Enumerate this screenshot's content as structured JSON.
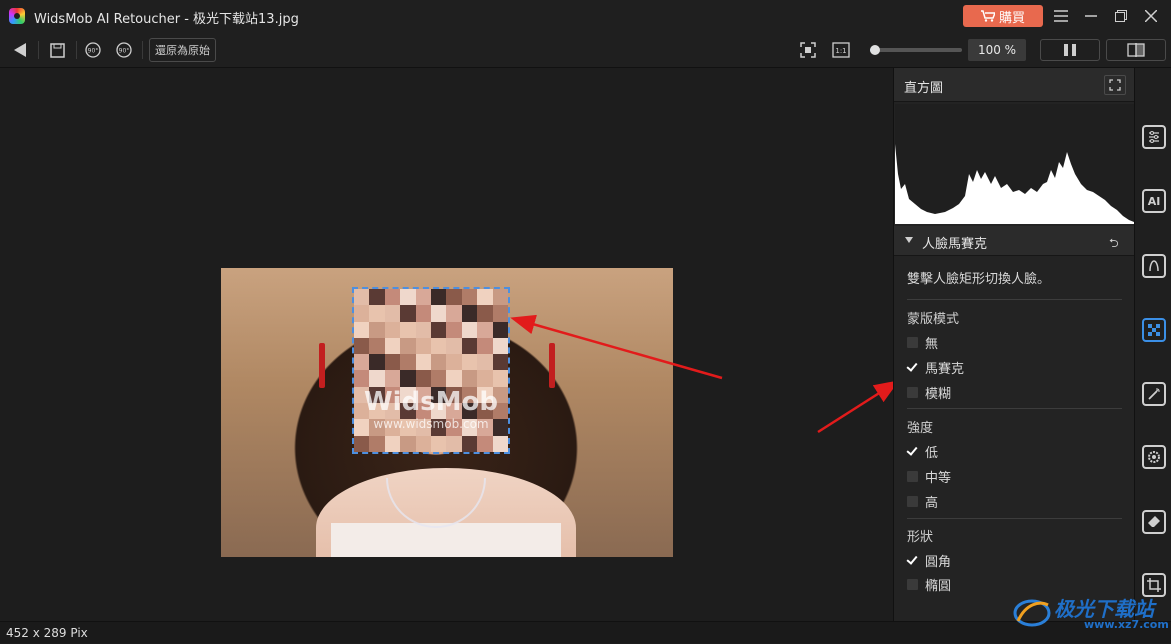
{
  "window": {
    "app_name": "WidsMob AI Retoucher",
    "title": "WidsMob AI Retoucher - 极光下载站13.jpg",
    "buy_label": "購買"
  },
  "toolbar": {
    "rotate_left_label": "90°",
    "rotate_right_label": "90°",
    "restore_label": "還原為原始",
    "fit_label": "1:1",
    "zoom_level": "100 %",
    "zoom_fraction": 0.05
  },
  "canvas": {
    "watermark_brand": "WidsMob",
    "watermark_url": "www.widsmob.com"
  },
  "status": {
    "dimensions": "452 x 289 Pix"
  },
  "panel": {
    "histogram_title": "直方圖",
    "section_title": "人臉馬賽克",
    "hint": "雙擊人臉矩形切換人臉。",
    "groups": [
      {
        "label": "蒙版模式",
        "options": [
          {
            "label": "無",
            "checked": false
          },
          {
            "label": "馬賽克",
            "checked": true
          },
          {
            "label": "模糊",
            "checked": false
          }
        ]
      },
      {
        "label": "強度",
        "options": [
          {
            "label": "低",
            "checked": true
          },
          {
            "label": "中等",
            "checked": false
          },
          {
            "label": "高",
            "checked": false
          }
        ]
      },
      {
        "label": "形狀",
        "options": [
          {
            "label": "圓角",
            "checked": true
          },
          {
            "label": "橢圓",
            "checked": false
          }
        ]
      }
    ]
  },
  "sidebar": {
    "tools": [
      "adjust-icon",
      "ai-icon",
      "retouch-icon",
      "mosaic-icon",
      "magic-wand-icon",
      "settings-icon",
      "eraser-icon",
      "crop-icon"
    ]
  },
  "site_watermark": {
    "name": "极光下载站",
    "url": "www.xz7.com"
  },
  "colors": {
    "accent": "#3b8fe6",
    "buy": "#e8694e",
    "arrow": "#e21b1b"
  }
}
